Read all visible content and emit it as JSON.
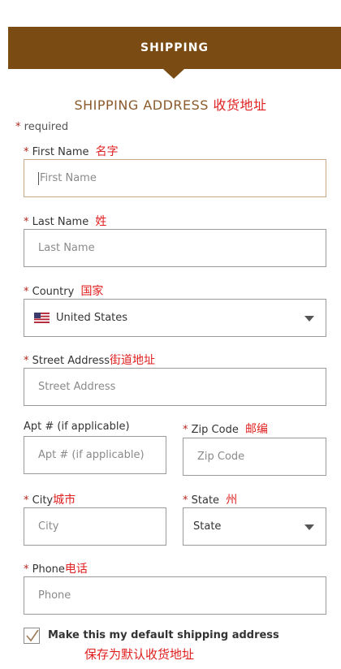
{
  "banner": {
    "title": "SHIPPING"
  },
  "section": {
    "title": "SHIPPING ADDRESS",
    "title_note": "收货地址"
  },
  "required_note": {
    "star": "*",
    "text": "required"
  },
  "fields": {
    "first_name": {
      "label": "First Name",
      "note": "名字",
      "placeholder": "First Name",
      "value": ""
    },
    "last_name": {
      "label": "Last Name",
      "note": "姓",
      "placeholder": "Last Name",
      "value": ""
    },
    "country": {
      "label": "Country",
      "note": "国家",
      "value": "United States",
      "flag_icon": "us-flag-icon"
    },
    "street": {
      "label": "Street Address",
      "note": "街道地址",
      "placeholder": "Street Address",
      "value": ""
    },
    "apt": {
      "label": "Apt # (if applicable)",
      "placeholder": "Apt # (if applicable)",
      "value": ""
    },
    "zip": {
      "label": "Zip Code",
      "note": "邮编",
      "placeholder": "Zip Code",
      "value": ""
    },
    "city": {
      "label": "City",
      "note": "城市",
      "placeholder": "City",
      "value": ""
    },
    "state": {
      "label": "State",
      "note": "州",
      "value": "State"
    },
    "phone": {
      "label": "Phone",
      "note": "电话",
      "placeholder": "Phone",
      "value": ""
    }
  },
  "default_address": {
    "label": "Make this my default shipping address",
    "note": "保存为默认收货地址",
    "checked": true
  },
  "colors": {
    "banner_bg": "#7a4b12",
    "title_brown": "#8b5a2b",
    "note_red": "#e02020",
    "required_star": "#b3261e"
  }
}
